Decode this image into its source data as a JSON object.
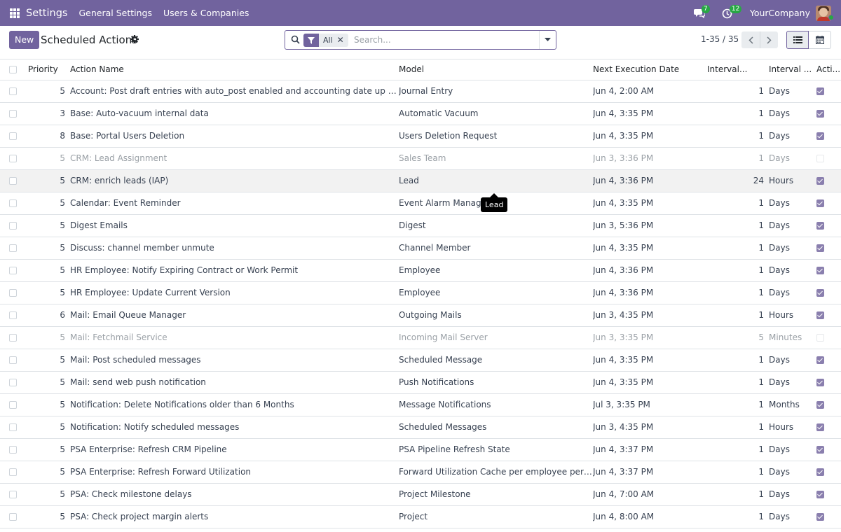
{
  "navbar": {
    "app_title": "Settings",
    "menus": [
      "General Settings",
      "Users & Companies"
    ],
    "messages_badge": "7",
    "activities_badge": "12",
    "company": "YourCompany",
    "bg_color": "#71639e"
  },
  "control": {
    "new_label": "New",
    "title": "Scheduled Actions",
    "filter_facet": "All",
    "search_placeholder": "Search...",
    "pager": "1-35 / 35"
  },
  "table": {
    "headers": {
      "priority": "Priority",
      "name": "Action Name",
      "model": "Model",
      "next_exec": "Next Execution Date",
      "interval_number": "Interval...",
      "interval_unit": "Interval ...",
      "active": "Acti..."
    },
    "rows": [
      {
        "priority": "5",
        "name": "Account: Post draft entries with auto_post enabled and accounting date up to to...",
        "model": "Journal Entry",
        "next_exec": "Jun 4, 2:00 AM",
        "interval": "1",
        "unit": "Days",
        "active": true
      },
      {
        "priority": "3",
        "name": "Base: Auto-vacuum internal data",
        "model": "Automatic Vacuum",
        "next_exec": "Jun 4, 3:35 PM",
        "interval": "1",
        "unit": "Days",
        "active": true
      },
      {
        "priority": "8",
        "name": "Base: Portal Users Deletion",
        "model": "Users Deletion Request",
        "next_exec": "Jun 4, 3:35 PM",
        "interval": "1",
        "unit": "Days",
        "active": true
      },
      {
        "priority": "5",
        "name": "CRM: Lead Assignment",
        "model": "Sales Team",
        "next_exec": "Jun 3, 3:36 PM",
        "interval": "1",
        "unit": "Days",
        "active": false
      },
      {
        "priority": "5",
        "name": "CRM: enrich leads (IAP)",
        "model": "Lead",
        "next_exec": "Jun 4, 3:36 PM",
        "interval": "24",
        "unit": "Hours",
        "active": true
      },
      {
        "priority": "5",
        "name": "Calendar: Event Reminder",
        "model": "Event Alarm Manager",
        "next_exec": "Jun 4, 3:35 PM",
        "interval": "1",
        "unit": "Days",
        "active": true
      },
      {
        "priority": "5",
        "name": "Digest Emails",
        "model": "Digest",
        "next_exec": "Jun 3, 5:36 PM",
        "interval": "1",
        "unit": "Days",
        "active": true
      },
      {
        "priority": "5",
        "name": "Discuss: channel member unmute",
        "model": "Channel Member",
        "next_exec": "Jun 4, 3:35 PM",
        "interval": "1",
        "unit": "Days",
        "active": true
      },
      {
        "priority": "5",
        "name": "HR Employee: Notify Expiring Contract or Work Permit",
        "model": "Employee",
        "next_exec": "Jun 4, 3:36 PM",
        "interval": "1",
        "unit": "Days",
        "active": true
      },
      {
        "priority": "5",
        "name": "HR Employee: Update Current Version",
        "model": "Employee",
        "next_exec": "Jun 4, 3:36 PM",
        "interval": "1",
        "unit": "Days",
        "active": true
      },
      {
        "priority": "6",
        "name": "Mail: Email Queue Manager",
        "model": "Outgoing Mails",
        "next_exec": "Jun 3, 4:35 PM",
        "interval": "1",
        "unit": "Hours",
        "active": true
      },
      {
        "priority": "5",
        "name": "Mail: Fetchmail Service",
        "model": "Incoming Mail Server",
        "next_exec": "Jun 3, 3:35 PM",
        "interval": "5",
        "unit": "Minutes",
        "active": false
      },
      {
        "priority": "5",
        "name": "Mail: Post scheduled messages",
        "model": "Scheduled Message",
        "next_exec": "Jun 4, 3:35 PM",
        "interval": "1",
        "unit": "Days",
        "active": true
      },
      {
        "priority": "5",
        "name": "Mail: send web push notification",
        "model": "Push Notifications",
        "next_exec": "Jun 4, 3:35 PM",
        "interval": "1",
        "unit": "Days",
        "active": true
      },
      {
        "priority": "5",
        "name": "Notification: Delete Notifications older than 6 Months",
        "model": "Message Notifications",
        "next_exec": "Jul 3, 3:35 PM",
        "interval": "1",
        "unit": "Months",
        "active": true
      },
      {
        "priority": "5",
        "name": "Notification: Notify scheduled messages",
        "model": "Scheduled Messages",
        "next_exec": "Jun 3, 4:35 PM",
        "interval": "1",
        "unit": "Hours",
        "active": true
      },
      {
        "priority": "5",
        "name": "PSA Enterprise: Refresh CRM Pipeline",
        "model": "PSA Pipeline Refresh State",
        "next_exec": "Jun 4, 3:37 PM",
        "interval": "1",
        "unit": "Days",
        "active": true
      },
      {
        "priority": "5",
        "name": "PSA Enterprise: Refresh Forward Utilization",
        "model": "Forward Utilization Cache per employee per ...",
        "next_exec": "Jun 4, 3:37 PM",
        "interval": "1",
        "unit": "Days",
        "active": true
      },
      {
        "priority": "5",
        "name": "PSA: Check milestone delays",
        "model": "Project Milestone",
        "next_exec": "Jun 4, 7:00 AM",
        "interval": "1",
        "unit": "Days",
        "active": true
      },
      {
        "priority": "5",
        "name": "PSA: Check project margin alerts",
        "model": "Project",
        "next_exec": "Jun 4, 8:00 AM",
        "interval": "1",
        "unit": "Days",
        "active": true
      }
    ]
  },
  "tooltip": {
    "text": "Lead"
  }
}
